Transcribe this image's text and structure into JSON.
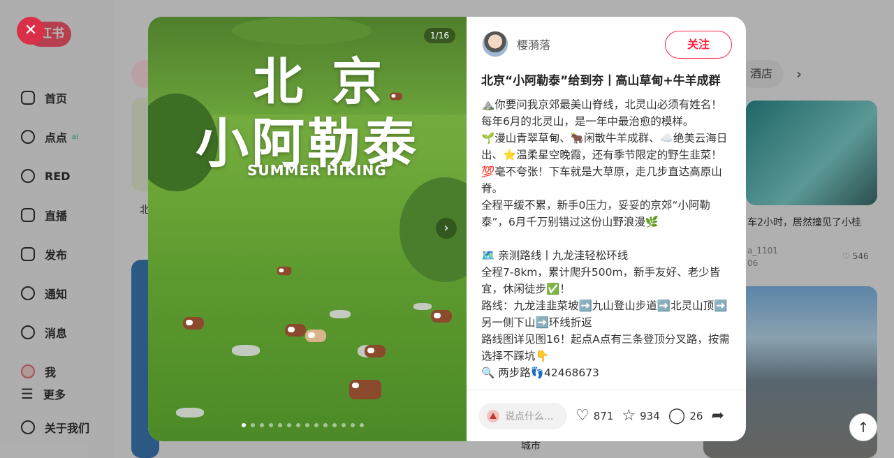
{
  "app": {
    "logo_text": "红书"
  },
  "sidebar": {
    "items": [
      {
        "label": "首页",
        "icon": "home-icon"
      },
      {
        "label": "点点",
        "icon": "chat-icon",
        "badge": "ai"
      },
      {
        "label": "RED",
        "icon": "play-icon"
      },
      {
        "label": "直播",
        "icon": "live-icon"
      },
      {
        "label": "发布",
        "icon": "plus-icon"
      },
      {
        "label": "通知",
        "icon": "bell-icon"
      },
      {
        "label": "消息",
        "icon": "message-icon"
      },
      {
        "label": "我",
        "icon": "avatar-icon"
      }
    ],
    "more_label": "更多",
    "about_label": "关于我们"
  },
  "feed": {
    "chip_label": "酒店",
    "right_card_title": "车2小时，居然撞见了小桂",
    "right_card_author": "a_1101",
    "right_card_sub": "06",
    "right_card_likes": "546",
    "left_card_title": "北",
    "bottom_card_title": "城市"
  },
  "post": {
    "image_counter": "1/16",
    "image_title_line1": "北 京",
    "image_title_line2": "小阿勒泰",
    "image_title_line3": "SUMMER HIKING",
    "author_name": "樱漪落",
    "follow_label": "关注",
    "title": "北京“小阿勒泰”给到夯丨高山草甸+牛羊成群",
    "body": [
      "⛰️你要问我京郊最美山脊线，北灵山必须有姓名！每年6月的北灵山，是一年中最治愈的模样。",
      "🌱漫山青翠草甸、🐂闲散牛羊成群、☁️绝美云海日出、⭐温柔星空晚霞，还有季节限定的野生韭菜！",
      "💯毫不夸张！下车就是大草原，走几步直达高原山脊。",
      "全程平缓不累，新手0压力，妥妥的京郊“小阿勒泰”，6月千万别错过这份山野浪漫🌿",
      "",
      "🗺️ 亲测路线丨九龙洼轻松环线",
      "全程7-8km，累计爬升500m，新手友好、老少皆宜，休闲徒步✅！",
      "路线：九龙洼韭菜坡➡️九山登山步道➡️北灵山顶➡️另一侧下山➡️环线折返",
      "路线图详见图16！起点A点有三条登顶分叉路，按需选择不踩坑👇",
      "🔍 两步路👣42468673"
    ],
    "comment_placeholder": "说点什么...",
    "likes": "871",
    "stars": "934",
    "comments": "26"
  }
}
